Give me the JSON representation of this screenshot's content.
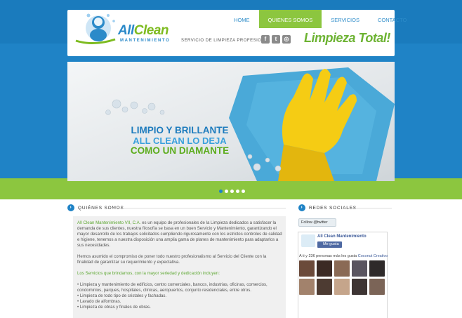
{
  "brand": {
    "logo_main_a": "All",
    "logo_main_b": "Clean",
    "logo_sub": "MANTENIMIENTO"
  },
  "nav": {
    "items": [
      "HOME",
      "QUIENES SOMOS",
      "SERVICIOS",
      "CONTACTO"
    ],
    "active": 1
  },
  "header": {
    "tagline": "SERVICIO DE LIMPIEZA PROFESIONAL",
    "social_icons": [
      "facebook-icon",
      "twitter-icon",
      "instagram-icon"
    ],
    "slogan": "Limpieza Total!"
  },
  "slider": {
    "line1": "LIMPIO Y BRILLANTE",
    "line2": "ALL CLEAN LO DEJA",
    "line3": "COMO UN DIAMANTE",
    "dots_count": 5,
    "active_dot": 0
  },
  "about": {
    "heading": "QUIÉNES SOMOS",
    "company_name": "All Clean Mantenimiento VII, C.A.",
    "p1_rest": " es un equipo de profesionales de la Limpieza dedicados a satisfacer la demanda de sus clientes, nuestra filosofía se basa en un buen Servicio y Mantenimiento, garantizando el mayor desarrollo de los trabajos solicitados cumpliendo rigurosamente con los estrictos controles de calidad e higiene, tenemos a nuestra disposición una amplia gama de planes de mantenimiento para adaptarlos a sus necesidades.",
    "p2": "Hemos asumido el compromiso de poner todo nuestro profesionalismo al Servicio del Cliente con la finalidad de garantizar  su requerimiento y expectativa.",
    "services_intro": "Los Servicios que brindamos, con la mayor seriedad y dedicación incluyen:",
    "services": [
      "Limpieza y  mantenimiento de  edificios, centro comerciales, bancos, industrias, oficinas, comercios, condominios, parques, hospitales, clínicas, aeropuertos, conjunto residenciales, entre otros.",
      "Limpieza de todo tipo de cristales y fachadas.",
      "Lavado de alfombras.",
      "Limpieza de obras y finales de obras."
    ]
  },
  "social_panel": {
    "heading": "REDES SOCIALES",
    "twitter_button": "Follow @twitter",
    "fb_page_name": "All Clean Mantenimiento",
    "fb_like_label": "Me gusta",
    "fb_count_text": "A ti y 236 personas más les gusta",
    "fb_count_link": "Coconut Creativo"
  },
  "colors": {
    "primary_blue": "#1f83c6",
    "accent_green": "#8cc63f",
    "dark_green": "#5ea833",
    "slide_glove": "#f5cc14",
    "slide_cloth": "#4aa9d8"
  }
}
